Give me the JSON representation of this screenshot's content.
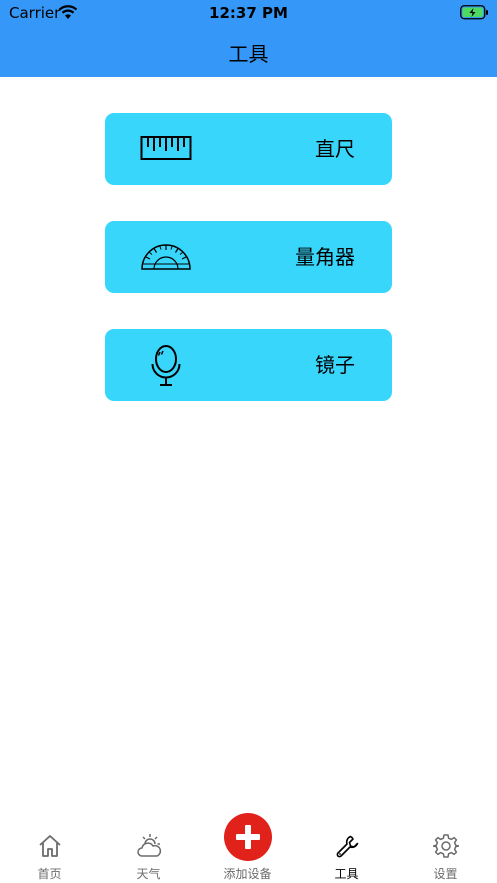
{
  "status": {
    "carrier": "Carrier",
    "time": "12:37 PM"
  },
  "header": {
    "title": "工具"
  },
  "tools": [
    {
      "label": "直尺",
      "icon": "ruler-icon"
    },
    {
      "label": "量角器",
      "icon": "protractor-icon"
    },
    {
      "label": "镜子",
      "icon": "mirror-icon"
    }
  ],
  "tabbar": {
    "items": [
      {
        "label": "首页",
        "icon": "home-icon"
      },
      {
        "label": "天气",
        "icon": "weather-icon"
      },
      {
        "label": "添加设备",
        "icon": "add-icon"
      },
      {
        "label": "工具",
        "icon": "wrench-icon",
        "active": true
      },
      {
        "label": "设置",
        "icon": "gear-icon"
      }
    ]
  },
  "colors": {
    "header": "#3598f8",
    "card": "#38d6fb",
    "add_button": "#e0221a",
    "battery": "#4cd964"
  }
}
